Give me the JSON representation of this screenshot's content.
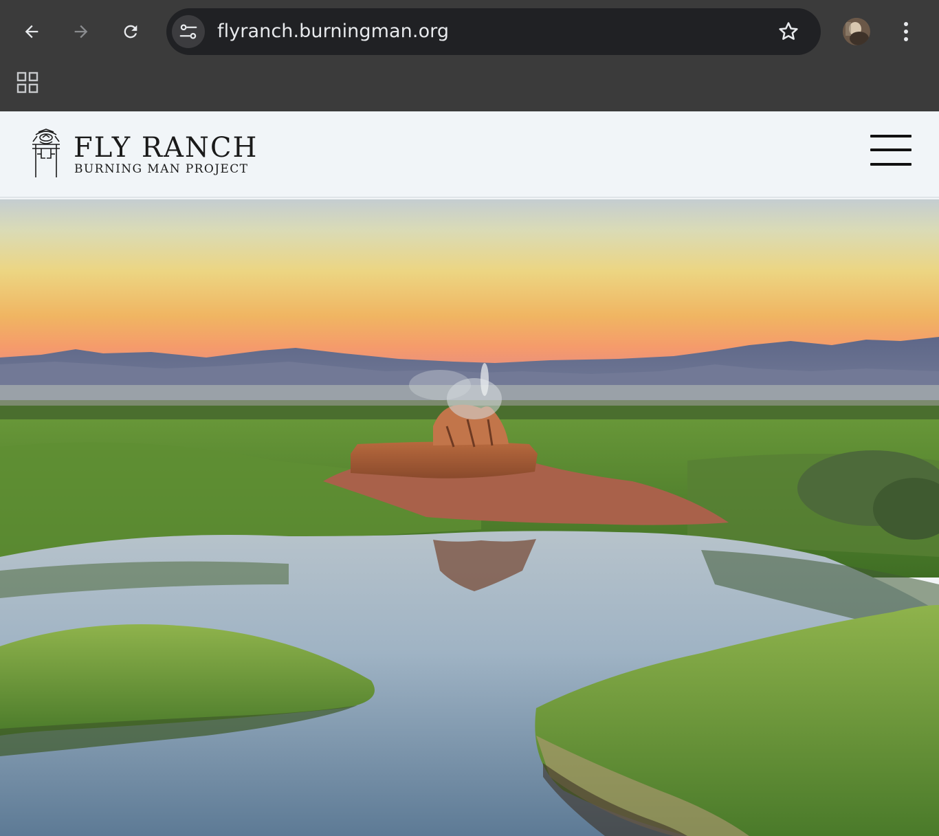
{
  "browser": {
    "url": "flyranch.burningman.org",
    "icons": [
      "back-arrow-icon",
      "forward-arrow-icon",
      "reload-icon",
      "site-settings-icon",
      "bookmark-star-icon",
      "profile-avatar",
      "more-menu-icon",
      "apps-grid-icon"
    ]
  },
  "site": {
    "logo_title": "FLY RANCH",
    "logo_subtitle": "BURNING MAN PROJECT",
    "menu_icon": "hamburger-menu-icon"
  },
  "hero": {
    "description_icon": "geyser-landscape-photo"
  },
  "colors": {
    "chrome_bg": "#3b3b3b",
    "omnibox_bg": "#202124",
    "header_bg": "#f1f5f8",
    "text_dark": "#1a1a1a"
  }
}
